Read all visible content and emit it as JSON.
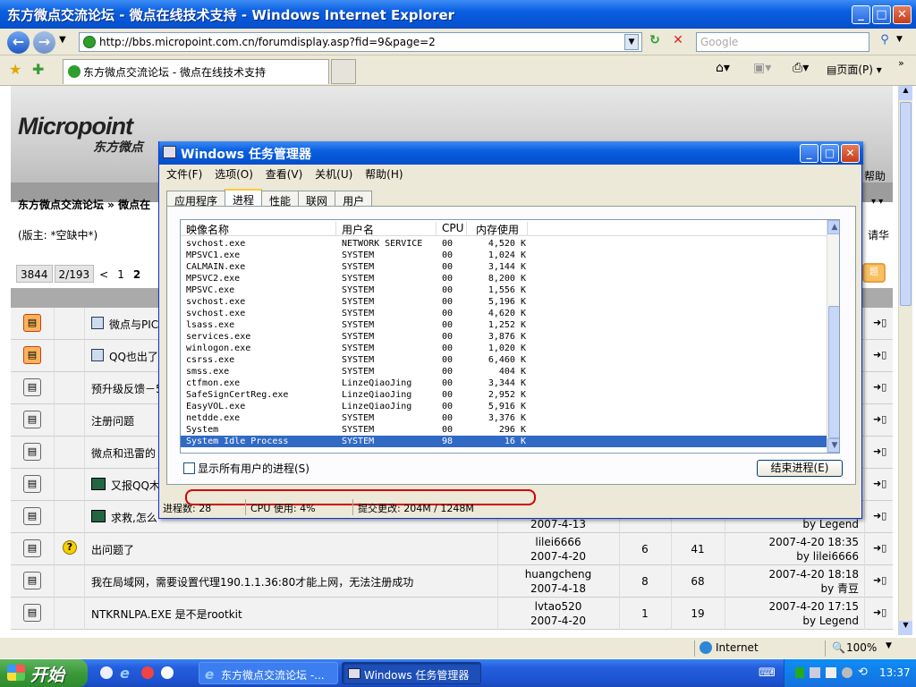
{
  "ie": {
    "title": "东方微点交流论坛 - 微点在线技术支持 - Windows Internet Explorer",
    "url": "http://bbs.micropoint.com.cn/forumdisplay.asp?fid=9&page=2",
    "search_placeholder": "Google",
    "tab_title": "东方微点交流论坛 - 微点在线技术支持",
    "page_menu": "页面(P)",
    "status_zone": "Internet",
    "zoom": "100%"
  },
  "forum": {
    "logo": "Micropoint",
    "logo_sub": "东方微点",
    "breadcrumb": "东方微点交流论坛 » 微点在",
    "moderator": "(版主: *空缺中*)",
    "right_help": "帮助",
    "right_name": "·",
    "right_hua": "请华",
    "pager": [
      "3844",
      "2/193",
      "<",
      "1",
      "2"
    ],
    "threads": [
      {
        "title": "微点与PIC",
        "hot": true,
        "tag": true
      },
      {
        "title": "QQ也出了",
        "hot": true,
        "tag": true
      },
      {
        "title": "预升级反馈－5",
        "hot": false
      },
      {
        "title": "注册问题",
        "hot": false
      },
      {
        "title": "微点和迅雷的",
        "hot": false
      },
      {
        "title": "又报QQ木",
        "hot": false,
        "eye": true
      },
      {
        "title": "求救,怎么",
        "hot": false,
        "eye": true,
        "date": "2007-4-13",
        "last_by": "by Legend"
      },
      {
        "title": "出问题了",
        "hot": false,
        "q": true,
        "author": "lilei6666",
        "date": "2007-4-20",
        "replies": "6",
        "views": "41",
        "last_time": "2007-4-20 18:35",
        "last_by": "by lilei6666"
      },
      {
        "title": "我在局域网，需要设置代理190.1.1.36:80才能上网，无法注册成功",
        "hot": false,
        "author": "huangcheng",
        "date": "2007-4-18",
        "replies": "8",
        "views": "68",
        "last_time": "2007-4-20 18:18",
        "last_by": "by 青豆"
      },
      {
        "title": "NTKRNLPA.EXE 是不是rootkit",
        "hot": false,
        "author": "lvtao520",
        "date": "2007-4-20",
        "replies": "1",
        "views": "19",
        "last_time": "2007-4-20 17:15",
        "last_by": "by Legend"
      }
    ]
  },
  "taskmgr": {
    "title": "Windows 任务管理器",
    "menu": [
      "文件(F)",
      "选项(O)",
      "查看(V)",
      "关机(U)",
      "帮助(H)"
    ],
    "tabs": [
      "应用程序",
      "进程",
      "性能",
      "联网",
      "用户"
    ],
    "active_tab": 1,
    "columns": [
      "映像名称",
      "用户名",
      "CPU",
      "内存使用"
    ],
    "processes": [
      [
        "svchost.exe",
        "NETWORK SERVICE",
        "00",
        "4,520 K"
      ],
      [
        "MPSVC1.exe",
        "SYSTEM",
        "00",
        "1,024 K"
      ],
      [
        "CALMAIN.exe",
        "SYSTEM",
        "00",
        "3,144 K"
      ],
      [
        "MPSVC2.exe",
        "SYSTEM",
        "00",
        "8,200 K"
      ],
      [
        "MPSVC.exe",
        "SYSTEM",
        "00",
        "1,556 K"
      ],
      [
        "svchost.exe",
        "SYSTEM",
        "00",
        "5,196 K"
      ],
      [
        "svchost.exe",
        "SYSTEM",
        "00",
        "4,620 K"
      ],
      [
        "lsass.exe",
        "SYSTEM",
        "00",
        "1,252 K"
      ],
      [
        "services.exe",
        "SYSTEM",
        "00",
        "3,876 K"
      ],
      [
        "winlogon.exe",
        "SYSTEM",
        "00",
        "1,020 K"
      ],
      [
        "csrss.exe",
        "SYSTEM",
        "00",
        "6,460 K"
      ],
      [
        "smss.exe",
        "SYSTEM",
        "00",
        "404 K"
      ],
      [
        "ctfmon.exe",
        "LinzeQiaoJing",
        "00",
        "3,344 K"
      ],
      [
        "SafeSignCertReg.exe",
        "LinzeQiaoJing",
        "00",
        "2,952 K"
      ],
      [
        "EasyVOL.exe",
        "LinzeQiaoJing",
        "00",
        "5,916 K"
      ],
      [
        "netdde.exe",
        "SYSTEM",
        "00",
        "3,376 K"
      ],
      [
        "System",
        "SYSTEM",
        "00",
        "296 K"
      ],
      [
        "System Idle Process",
        "SYSTEM",
        "98",
        "16 K"
      ]
    ],
    "selected_index": 17,
    "show_all_label": "显示所有用户的进程(S)",
    "end_process_label": "结束进程(E)",
    "status_count": "进程数: 28",
    "status_cpu": "CPU 使用: 4%",
    "status_commit": "提交更改: 204M / 1248M"
  },
  "taskbar": {
    "start": "开始",
    "tasks": [
      "东方微点交流论坛 -...",
      "Windows 任务管理器"
    ],
    "clock": "13:37"
  },
  "colors": {
    "xp_blue": "#0a5fe0",
    "selected_row": "#316ac5",
    "highlight": "#d20000"
  }
}
